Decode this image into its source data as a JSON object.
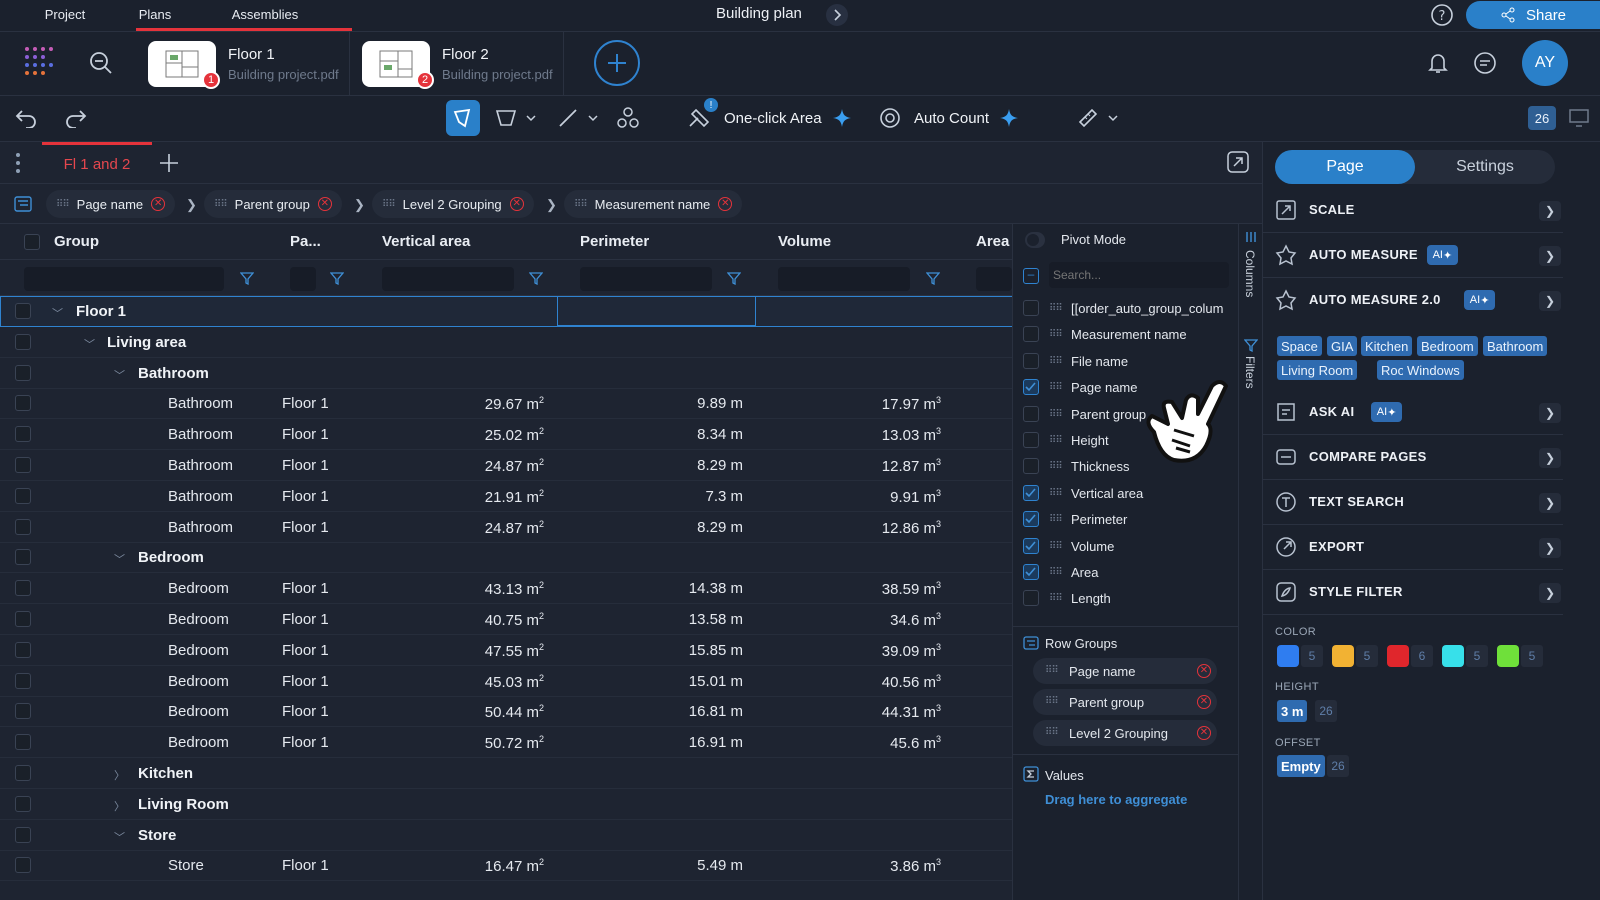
{
  "topbar": {
    "tabs": [
      "Project",
      "Plans",
      "Assemblies"
    ],
    "title": "Building plan",
    "share_label": "Share"
  },
  "files": [
    {
      "name": "Floor 1",
      "sub": "Building project.pdf",
      "badge": "1"
    },
    {
      "name": "Floor 2",
      "sub": "Building project.pdf",
      "badge": "2"
    }
  ],
  "user": {
    "initials": "AY"
  },
  "toolbar": {
    "one_click_label": "One-click Area",
    "auto_count_label": "Auto Count",
    "page_count": "26"
  },
  "view": {
    "active_tab": "Fl 1 and 2"
  },
  "grouping": [
    "Page name",
    "Parent group",
    "Level 2 Grouping",
    "Measurement name"
  ],
  "columns": [
    "Group",
    "Pa...",
    "Vertical area",
    "Perimeter",
    "Volume",
    "Area"
  ],
  "rows": [
    {
      "level": 0,
      "label": "Floor 1",
      "expanded": true
    },
    {
      "level": 1,
      "label": "Living area",
      "expanded": true
    },
    {
      "level": 2,
      "label": "Bathroom",
      "expanded": true
    },
    {
      "level": 3,
      "label": "Bathroom",
      "page": "Floor 1",
      "varea": "29.67",
      "perim": "9.89 m",
      "vol": "17.97"
    },
    {
      "level": 3,
      "label": "Bathroom",
      "page": "Floor 1",
      "varea": "25.02",
      "perim": "8.34 m",
      "vol": "13.03"
    },
    {
      "level": 3,
      "label": "Bathroom",
      "page": "Floor 1",
      "varea": "24.87",
      "perim": "8.29 m",
      "vol": "12.87"
    },
    {
      "level": 3,
      "label": "Bathroom",
      "page": "Floor 1",
      "varea": "21.91",
      "perim": "7.3 m",
      "vol": "9.91"
    },
    {
      "level": 3,
      "label": "Bathroom",
      "page": "Floor 1",
      "varea": "24.87",
      "perim": "8.29 m",
      "vol": "12.86"
    },
    {
      "level": 2,
      "label": "Bedroom",
      "expanded": true
    },
    {
      "level": 3,
      "label": "Bedroom",
      "page": "Floor 1",
      "varea": "43.13",
      "perim": "14.38 m",
      "vol": "38.59"
    },
    {
      "level": 3,
      "label": "Bedroom",
      "page": "Floor 1",
      "varea": "40.75",
      "perim": "13.58 m",
      "vol": "34.6"
    },
    {
      "level": 3,
      "label": "Bedroom",
      "page": "Floor 1",
      "varea": "47.55",
      "perim": "15.85 m",
      "vol": "39.09"
    },
    {
      "level": 3,
      "label": "Bedroom",
      "page": "Floor 1",
      "varea": "45.03",
      "perim": "15.01 m",
      "vol": "40.56"
    },
    {
      "level": 3,
      "label": "Bedroom",
      "page": "Floor 1",
      "varea": "50.44",
      "perim": "16.81 m",
      "vol": "44.31"
    },
    {
      "level": 3,
      "label": "Bedroom",
      "page": "Floor 1",
      "varea": "50.72",
      "perim": "16.91 m",
      "vol": "45.6"
    },
    {
      "level": 2,
      "label": "Kitchen",
      "expanded": false
    },
    {
      "level": 2,
      "label": "Living Room",
      "expanded": false
    },
    {
      "level": 2,
      "label": "Store",
      "expanded": true
    },
    {
      "level": 3,
      "label": "Store",
      "page": "Floor 1",
      "varea": "16.47",
      "perim": "5.49 m",
      "vol": "3.86"
    }
  ],
  "units": {
    "area": "m",
    "area_sup": "2",
    "vol": "m",
    "vol_sup": "3"
  },
  "colpanel": {
    "pivot_label": "Pivot Mode",
    "search_placeholder": "Search...",
    "items": [
      {
        "label": "[[order_auto_group_colum",
        "checked": false
      },
      {
        "label": "Measurement name",
        "checked": false
      },
      {
        "label": "File name",
        "checked": false
      },
      {
        "label": "Page name",
        "checked": true
      },
      {
        "label": "Parent group",
        "checked": false
      },
      {
        "label": "Height",
        "checked": false
      },
      {
        "label": "Thickness",
        "checked": false
      },
      {
        "label": "Vertical area",
        "checked": true
      },
      {
        "label": "Perimeter",
        "checked": true
      },
      {
        "label": "Volume",
        "checked": true
      },
      {
        "label": "Area",
        "checked": true
      },
      {
        "label": "Length",
        "checked": false
      }
    ],
    "row_groups_label": "Row Groups",
    "row_groups": [
      "Page name",
      "Parent group",
      "Level 2 Grouping"
    ],
    "values_label": "Values",
    "values_hint": "Drag here to aggregate",
    "strip": [
      "Columns",
      "Filters"
    ]
  },
  "rightpanel": {
    "seg": [
      "Page",
      "Settings"
    ],
    "menu": [
      {
        "label": "SCALE",
        "icon": "scale-icon",
        "ai": false
      },
      {
        "label": "AUTO MEASURE",
        "icon": "auto-measure-icon",
        "ai": true
      },
      {
        "label": "AUTO MEASURE 2.0",
        "icon": "auto-measure-2-icon",
        "ai": true
      },
      {
        "label": "ASK AI",
        "icon": "ask-ai-icon",
        "ai": true
      },
      {
        "label": "COMPARE PAGES",
        "icon": "compare-icon",
        "ai": false
      },
      {
        "label": "TEXT SEARCH",
        "icon": "text-search-icon",
        "ai": false
      },
      {
        "label": "EXPORT",
        "icon": "export-icon",
        "ai": false
      },
      {
        "label": "STYLE FILTER",
        "icon": "style-filter-icon",
        "ai": false
      }
    ],
    "ai_badge": "AI",
    "tags": [
      "Space",
      "GIA",
      "Kitchen",
      "Bedroom",
      "Bathroom",
      "Living Room",
      "Roof",
      "Windows"
    ],
    "color_label": "COLOR",
    "colors": [
      {
        "hex": "#2f7df0",
        "count": "5"
      },
      {
        "hex": "#f2b233",
        "count": "5"
      },
      {
        "hex": "#e0262c",
        "count": "6"
      },
      {
        "hex": "#37e0ea",
        "count": "5"
      },
      {
        "hex": "#6fe03a",
        "count": "5"
      }
    ],
    "height_label": "HEIGHT",
    "height_value": "3 m",
    "height_count": "26",
    "offset_label": "OFFSET",
    "offset_value": "Empty",
    "offset_count": "26"
  }
}
